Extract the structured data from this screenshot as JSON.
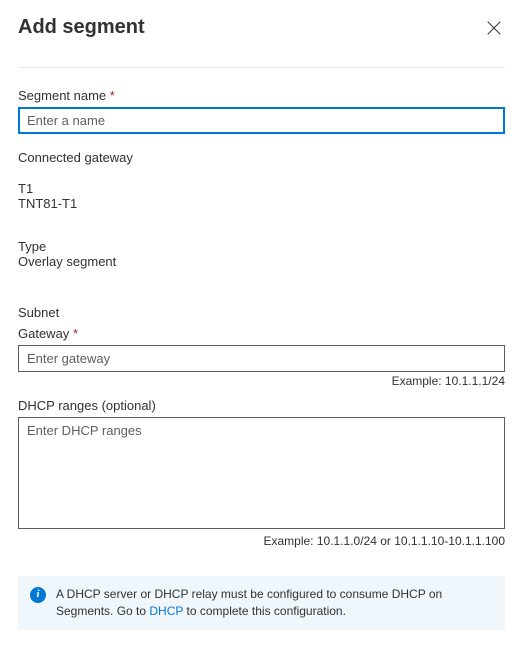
{
  "header": {
    "title": "Add segment"
  },
  "segment_name": {
    "label": "Segment name",
    "required_mark": "*",
    "placeholder": "Enter a name",
    "value": ""
  },
  "connected_gateway": {
    "heading": "Connected gateway",
    "tier_label": "T1",
    "tier_value": "TNT81-T1"
  },
  "type": {
    "label": "Type",
    "value": "Overlay segment"
  },
  "subnet": {
    "heading": "Subnet",
    "gateway_label": "Gateway",
    "gateway_required_mark": "*",
    "gateway_placeholder": "Enter gateway",
    "gateway_value": "",
    "gateway_example": "Example: 10.1.1.1/24",
    "dhcp_label": "DHCP ranges (optional)",
    "dhcp_placeholder": "Enter DHCP ranges",
    "dhcp_value": "",
    "dhcp_example": "Example: 10.1.1.0/24 or 10.1.1.10-10.1.1.100"
  },
  "info": {
    "text_before": "A DHCP server or DHCP relay must be configured to consume DHCP on Segments. Go to ",
    "link_text": "DHCP",
    "text_after": " to complete this configuration."
  }
}
